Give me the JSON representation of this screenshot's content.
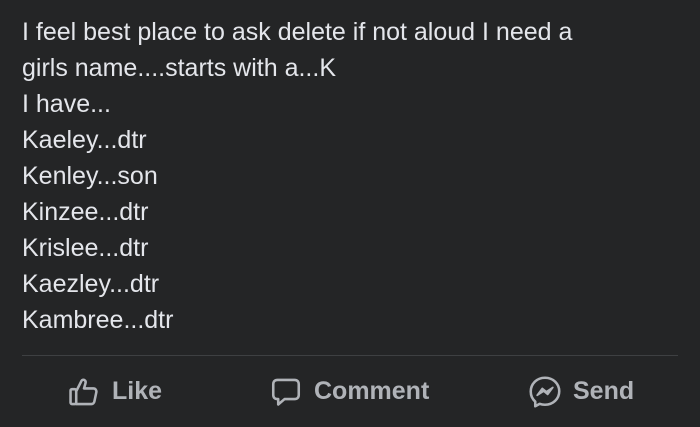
{
  "post": {
    "lines": [
      "I feel best place to ask delete if not aloud I need a",
      "girls name....starts with a...K",
      "I have...",
      "Kaeley...dtr",
      "Kenley...son",
      "Kinzee...dtr",
      "Krislee...dtr",
      "Kaezley...dtr",
      "Kambree...dtr"
    ]
  },
  "actions": {
    "like": {
      "label": "Like",
      "icon": "thumbs-up-icon"
    },
    "comment": {
      "label": "Comment",
      "icon": "speech-bubble-icon"
    },
    "send": {
      "label": "Send",
      "icon": "messenger-icon"
    }
  },
  "colors": {
    "background": "#242526",
    "text": "#e4e6eb",
    "action_text": "#b0b3b8",
    "divider": "#3e4042"
  }
}
